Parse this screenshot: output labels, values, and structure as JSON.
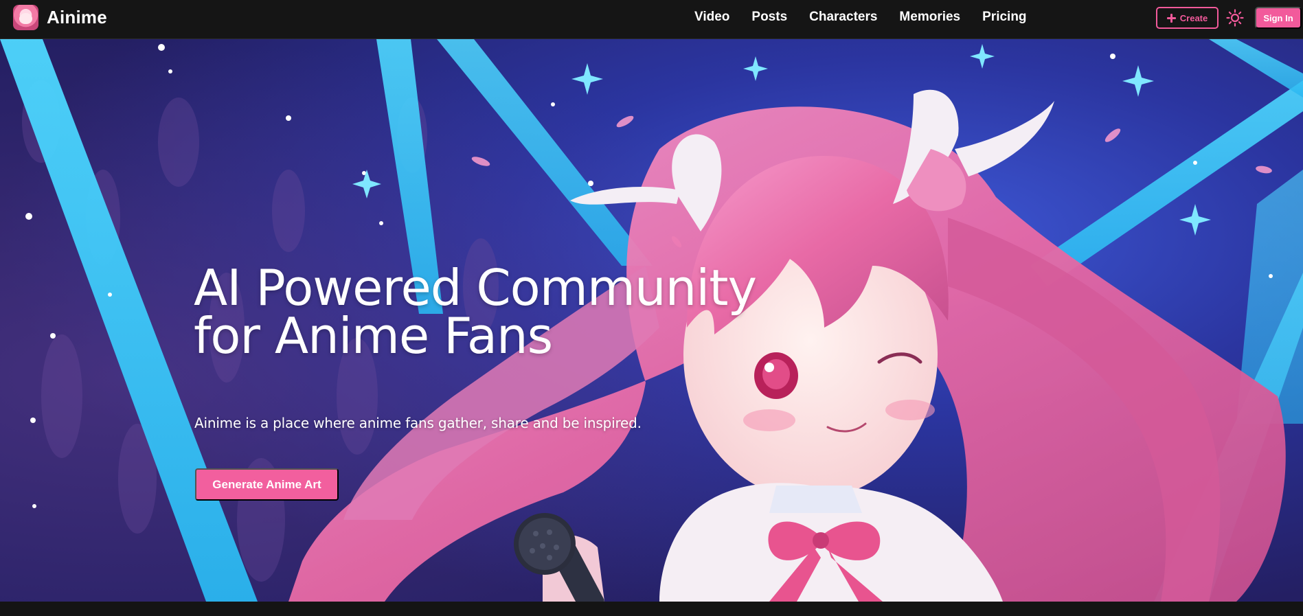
{
  "brand": {
    "name": "Ainime",
    "logo_icon": "anime-girl-avatar-icon"
  },
  "nav": {
    "links": [
      "Video",
      "Posts",
      "Characters",
      "Memories",
      "Pricing"
    ]
  },
  "actions": {
    "create_label": "Create",
    "create_icon": "plus-icon",
    "theme_icon": "sun-icon",
    "signin_label": "Sign In"
  },
  "hero": {
    "headline_line1": "AI Powered Community",
    "headline_line2": "for Anime Fans",
    "subtitle": "Ainime is a place where anime fans gather, share and be inspired.",
    "cta_label": "Generate Anime Art",
    "background_image": "anime-idol-girl-with-microphone"
  },
  "colors": {
    "accent": "#f25a9b",
    "navbar": "#151515",
    "hero_blue": "#27339a",
    "spotlight": "#36c6f5",
    "hair_pink": "#ec6ea8"
  }
}
